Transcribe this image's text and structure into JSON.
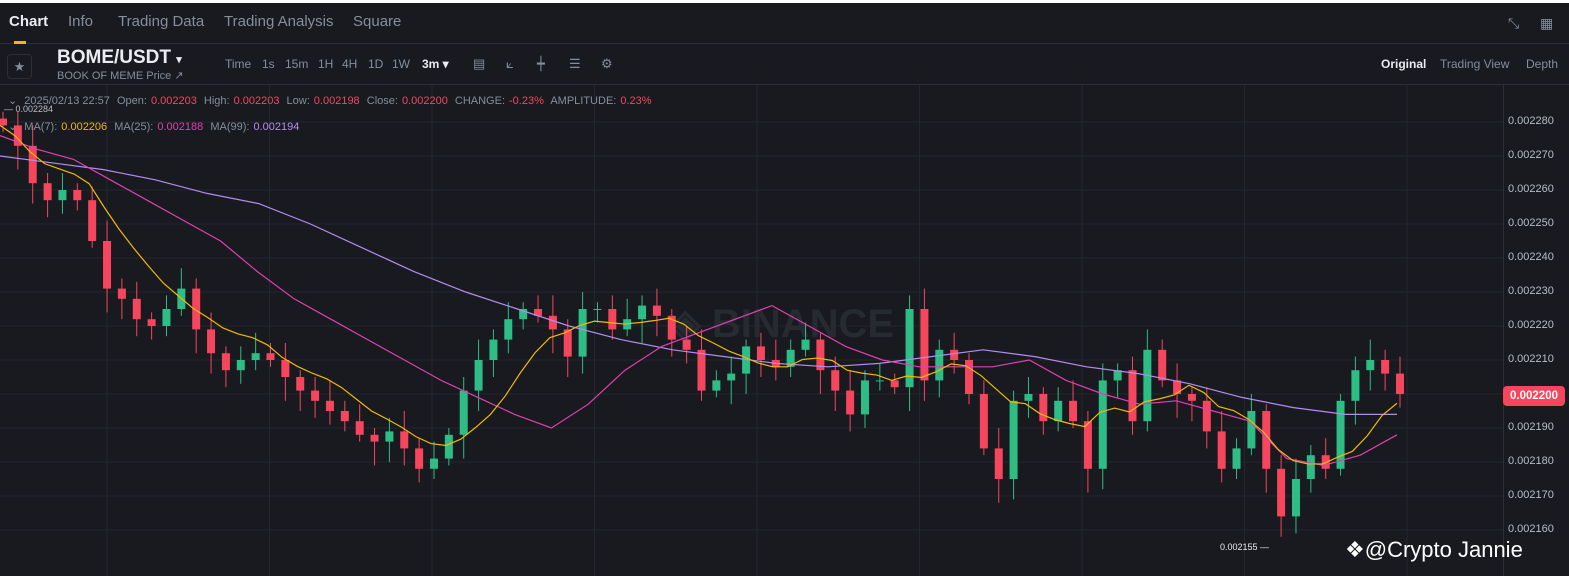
{
  "tabs": [
    "Chart",
    "Info",
    "Trading Data",
    "Trading Analysis",
    "Square"
  ],
  "pair": {
    "symbol": "BOME/USDT",
    "subtitle": "BOOK OF MEME Price ↗"
  },
  "timeframes": [
    "Time",
    "1s",
    "15m",
    "1H",
    "4H",
    "1D",
    "1W",
    "3m ▾"
  ],
  "toolbar_icons": [
    "calendar-icon",
    "indicator-icon",
    "candle-type-icon",
    "template-icon",
    "settings-icon"
  ],
  "views": [
    "Original",
    "Trading View",
    "Depth"
  ],
  "ohlc": {
    "date": "2025/02/13 22:57",
    "open_label": "Open:",
    "open": "0.002203",
    "high_label": "High:",
    "high": "0.002203",
    "low_label": "Low:",
    "low": "0.002198",
    "close_label": "Close:",
    "close": "0.002200",
    "change_label": "CHANGE:",
    "change": "-0.23%",
    "amp_label": "AMPLITUDE:",
    "amplitude": "0.23%"
  },
  "ma": {
    "ma7_label": "MA(7):",
    "ma7": "0.002206",
    "ma25_label": "MA(25):",
    "ma25": "0.002188",
    "ma99_label": "MA(99):",
    "ma99": "0.002194"
  },
  "colors": {
    "up": "#2ebd85",
    "down": "#f6465d",
    "ma7": "#f0b90b",
    "ma25": "#e040b0",
    "ma99": "#b48cf0"
  },
  "watermark": "@Crypto Jannie",
  "chart_data": {
    "type": "candlestick",
    "title": "BOME/USDT 3m",
    "ylim": [
      0.002155,
      0.002284
    ],
    "yticks": [
      "0.002280",
      "0.002270",
      "0.002260",
      "0.002250",
      "0.002240",
      "0.002230",
      "0.002220",
      "0.002210",
      "0.002200",
      "0.002190",
      "0.002180",
      "0.002170",
      "0.002160"
    ],
    "last_price": "0.002200",
    "high_marker": "0.002284",
    "low_marker": "0.002155",
    "closes_millionths": [
      2279,
      2273,
      2262,
      2257,
      2260,
      2257,
      2245,
      2231,
      2228,
      2222,
      2220,
      2225,
      2231,
      2219,
      2212,
      2207,
      2210,
      2212,
      2210,
      2205,
      2201,
      2198,
      2195,
      2192,
      2188,
      2186,
      2189,
      2184,
      2178,
      2181,
      2188,
      2201,
      2210,
      2216,
      2222,
      2225,
      2223,
      2219,
      2211,
      2225,
      2225,
      2219,
      2222,
      2226,
      2223,
      2216,
      2213,
      2201,
      2204,
      2206,
      2214,
      2210,
      2208,
      2213,
      2216,
      2207,
      2201,
      2194,
      2204,
      2204,
      2202,
      2225,
      2204,
      2213,
      2210,
      2200,
      2184,
      2175,
      2198,
      2200,
      2192,
      2198,
      2192,
      2178,
      2204,
      2207,
      2192,
      2213,
      2204,
      2200,
      2198,
      2189,
      2178,
      2184,
      2195,
      2178,
      2164,
      2175,
      2182,
      2178,
      2198,
      2207,
      2210,
      2206,
      2200
    ],
    "ma25_millionths": [
      2276,
      2272,
      2269,
      2263,
      2257,
      2251,
      2245,
      2236,
      2228,
      2222,
      2216,
      2210,
      2204,
      2199,
      2194,
      2190,
      2197,
      2207,
      2214,
      2218,
      2222,
      2226,
      2220,
      2214,
      2210,
      2208,
      2208,
      2208,
      2210,
      2204,
      2200,
      2197,
      2198,
      2195,
      2192,
      2181,
      2179,
      2182,
      2188
    ],
    "ma99_millionths": [
      2270,
      2268,
      2266,
      2263,
      2259,
      2256,
      2250,
      2243,
      2236,
      2230,
      2225,
      2220,
      2216,
      2213,
      2211,
      2209,
      2208,
      2209,
      2211,
      2213,
      2211,
      2208,
      2206,
      2203,
      2199,
      2196,
      2194,
      2194
    ]
  }
}
